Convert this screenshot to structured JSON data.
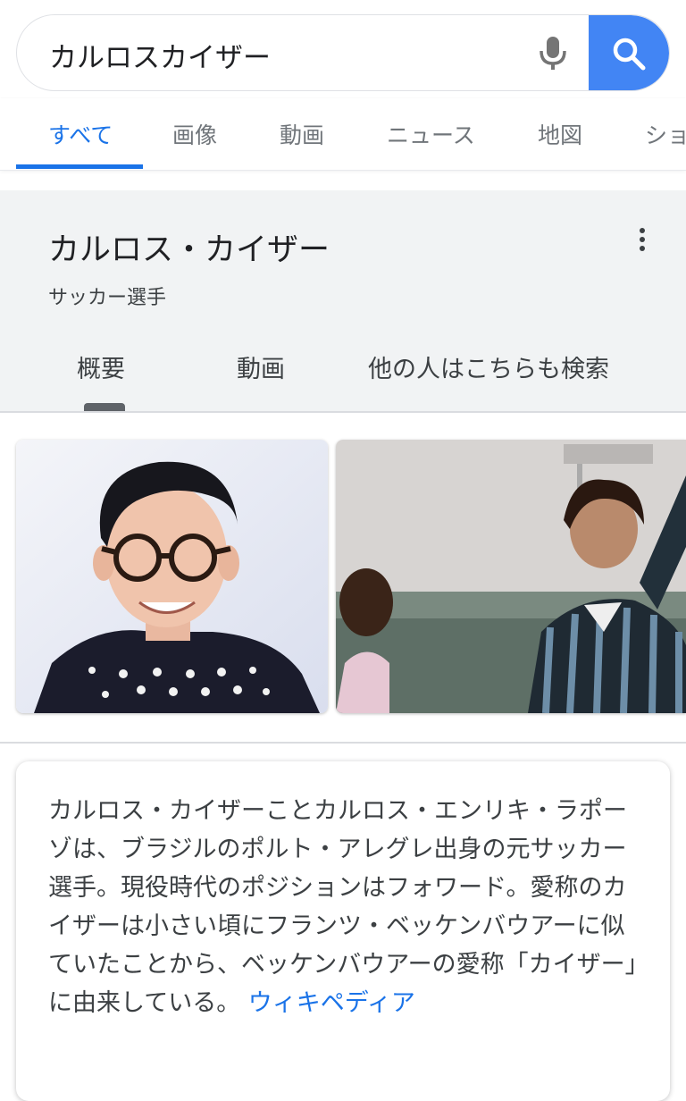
{
  "search": {
    "query": "カルロスカイザー"
  },
  "tabs": [
    {
      "label": "すべて",
      "active": true
    },
    {
      "label": "画像",
      "active": false
    },
    {
      "label": "動画",
      "active": false
    },
    {
      "label": "ニュース",
      "active": false
    },
    {
      "label": "地図",
      "active": false
    },
    {
      "label": "ショ",
      "active": false
    }
  ],
  "knowledge_panel": {
    "title": "カルロス・カイザー",
    "subtitle": "サッカー選手",
    "tabs": [
      {
        "label": "概要",
        "active": true
      },
      {
        "label": "動画",
        "active": false
      },
      {
        "label": "他の人はこちらも検索",
        "active": false
      }
    ]
  },
  "description": {
    "text": "カルロス・カイザーことカルロス・エンリキ・ラポーゾは、ブラジルのポルト・アレグレ出身の元サッカー選手。現役時代のポジションはフォワード。愛称のカイザーは小さい頃にフランツ・ベッケンバウアーに似ていたことから、ベッケンバウアーの愛称「カイザー」に由来している。",
    "source_link": "ウィキペディア"
  },
  "colors": {
    "accent": "#1a73e8",
    "search_button": "#4285f4",
    "panel_bg": "#f1f3f4"
  },
  "icons": {
    "mic": "microphone-icon",
    "search": "magnifier-icon",
    "menu": "more-vertical-icon"
  }
}
